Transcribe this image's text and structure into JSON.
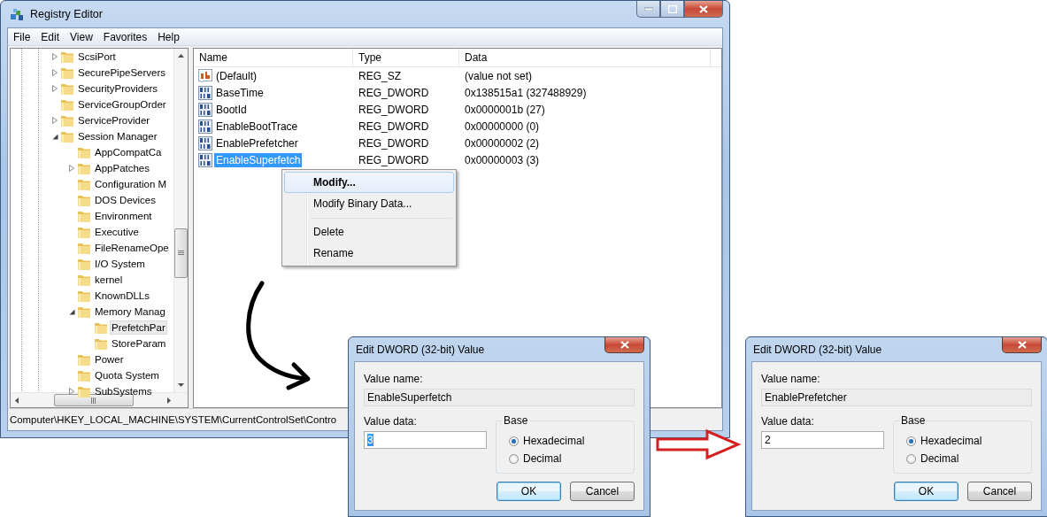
{
  "registry_editor": {
    "title": "Registry Editor",
    "menu": [
      "File",
      "Edit",
      "View",
      "Favorites",
      "Help"
    ],
    "tree": {
      "items": [
        {
          "label": "ScsiPort",
          "expandable": true,
          "expanded": false,
          "selected": false
        },
        {
          "label": "SecurePipeServers",
          "expandable": true,
          "expanded": false,
          "selected": false
        },
        {
          "label": "SecurityProviders",
          "expandable": true,
          "expanded": false,
          "selected": false
        },
        {
          "label": "ServiceGroupOrder",
          "expandable": false,
          "selected": false
        },
        {
          "label": "ServiceProvider",
          "expandable": true,
          "expanded": false,
          "selected": false
        },
        {
          "label": "Session Manager",
          "expandable": true,
          "expanded": true,
          "selected": false,
          "children": [
            {
              "label": "AppCompatCa",
              "expandable": false,
              "selected": false
            },
            {
              "label": "AppPatches",
              "expandable": true,
              "expanded": false,
              "selected": false
            },
            {
              "label": "Configuration M",
              "expandable": false,
              "selected": false
            },
            {
              "label": "DOS Devices",
              "expandable": false,
              "selected": false
            },
            {
              "label": "Environment",
              "expandable": false,
              "selected": false
            },
            {
              "label": "Executive",
              "expandable": false,
              "selected": false
            },
            {
              "label": "FileRenameOpe",
              "expandable": false,
              "selected": false
            },
            {
              "label": "I/O System",
              "expandable": false,
              "selected": false
            },
            {
              "label": "kernel",
              "expandable": false,
              "selected": false
            },
            {
              "label": "KnownDLLs",
              "expandable": false,
              "selected": false
            },
            {
              "label": "Memory Manag",
              "expandable": true,
              "expanded": true,
              "selected": false,
              "children": [
                {
                  "label": "PrefetchPar",
                  "expandable": false,
                  "selected": true
                },
                {
                  "label": "StoreParam",
                  "expandable": false,
                  "selected": false
                }
              ]
            },
            {
              "label": "Power",
              "expandable": false,
              "selected": false
            },
            {
              "label": "Quota System",
              "expandable": false,
              "selected": false
            },
            {
              "label": "SubSystems",
              "expandable": true,
              "expanded": false,
              "selected": false
            }
          ]
        }
      ]
    },
    "values_table": {
      "columns": [
        "Name",
        "Type",
        "Data"
      ],
      "rows": [
        {
          "name": "(Default)",
          "type": "REG_SZ",
          "data": "(value not set)",
          "kind": "string",
          "selected": false
        },
        {
          "name": "BaseTime",
          "type": "REG_DWORD",
          "data": "0x138515a1 (327488929)",
          "kind": "binary",
          "selected": false
        },
        {
          "name": "BootId",
          "type": "REG_DWORD",
          "data": "0x0000001b (27)",
          "kind": "binary",
          "selected": false
        },
        {
          "name": "EnableBootTrace",
          "type": "REG_DWORD",
          "data": "0x00000000 (0)",
          "kind": "binary",
          "selected": false
        },
        {
          "name": "EnablePrefetcher",
          "type": "REG_DWORD",
          "data": "0x00000002 (2)",
          "kind": "binary",
          "selected": false
        },
        {
          "name": "EnableSuperfetch",
          "type": "REG_DWORD",
          "data": "0x00000003 (3)",
          "kind": "binary",
          "selected": true
        }
      ]
    },
    "context_menu": {
      "items": [
        {
          "label": "Modify...",
          "default": true,
          "highlighted": true,
          "separator_before": false
        },
        {
          "label": "Modify Binary Data...",
          "default": false,
          "highlighted": false,
          "separator_before": false
        },
        {
          "label": "Delete",
          "default": false,
          "highlighted": false,
          "separator_before": true
        },
        {
          "label": "Rename",
          "default": false,
          "highlighted": false,
          "separator_before": false
        }
      ]
    },
    "status_bar": "Computer\\HKEY_LOCAL_MACHINE\\SYSTEM\\CurrentControlSet\\Contro"
  },
  "dialogs": [
    {
      "title": "Edit DWORD (32-bit) Value",
      "value_name_label": "Value name:",
      "value_name": "EnableSuperfetch",
      "value_data_label": "Value data:",
      "value_data": "3",
      "value_data_highlighted": true,
      "base_label": "Base",
      "options": [
        {
          "label": "Hexadecimal",
          "selected": true
        },
        {
          "label": "Decimal",
          "selected": false
        }
      ],
      "buttons": [
        {
          "label": "OK",
          "default": true
        },
        {
          "label": "Cancel",
          "default": false
        }
      ]
    },
    {
      "title": "Edit DWORD (32-bit) Value",
      "value_name_label": "Value name:",
      "value_name": "EnablePrefetcher",
      "value_data_label": "Value data:",
      "value_data": "2",
      "value_data_highlighted": false,
      "base_label": "Base",
      "options": [
        {
          "label": "Hexadecimal",
          "selected": true
        },
        {
          "label": "Decimal",
          "selected": false
        }
      ],
      "buttons": [
        {
          "label": "OK",
          "default": true
        },
        {
          "label": "Cancel",
          "default": false
        }
      ]
    }
  ]
}
